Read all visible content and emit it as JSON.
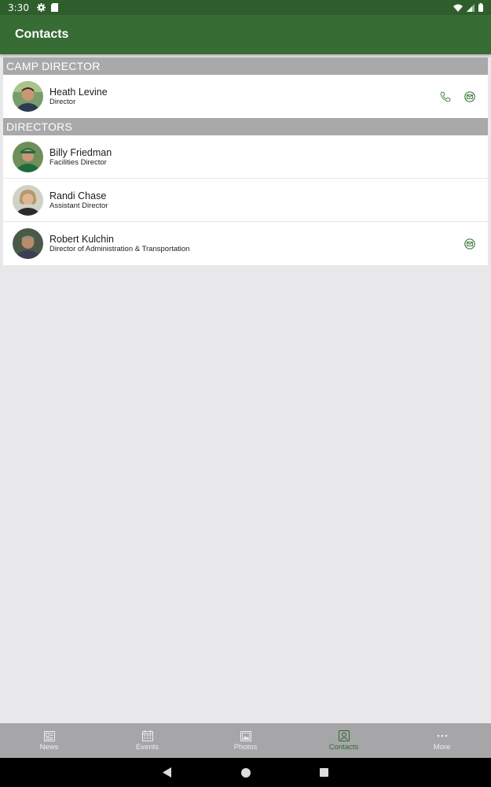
{
  "status_bar": {
    "time": "3:30",
    "icons": [
      "gear-icon",
      "sd-card-icon",
      "wifi-icon",
      "signal-icon",
      "battery-icon"
    ]
  },
  "app_bar": {
    "title": "Contacts",
    "color": "#376c34"
  },
  "sections": [
    {
      "header": "CAMP DIRECTOR",
      "contacts": [
        {
          "name": "Heath Levine",
          "role": "Director",
          "phone": true,
          "email": true
        }
      ]
    },
    {
      "header": "DIRECTORS",
      "contacts": [
        {
          "name": "Billy Friedman",
          "role": "Facilities Director",
          "phone": false,
          "email": false
        },
        {
          "name": "Randi Chase",
          "role": "Assistant Director",
          "phone": false,
          "email": false
        },
        {
          "name": "Robert Kulchin",
          "role": "Director of Administration & Transportation",
          "phone": false,
          "email": true
        }
      ]
    }
  ],
  "bottom_nav": {
    "items": [
      {
        "label": "News",
        "icon": "newspaper-icon",
        "active": false
      },
      {
        "label": "Events",
        "icon": "calendar-icon",
        "active": false
      },
      {
        "label": "Photos",
        "icon": "photo-icon",
        "active": false
      },
      {
        "label": "Contacts",
        "icon": "contacts-icon",
        "active": true
      },
      {
        "label": "More",
        "icon": "more-dots-icon",
        "active": false
      }
    ],
    "active_color": "#2f6a2e"
  },
  "system_nav": [
    "back-icon",
    "home-icon",
    "recents-icon"
  ]
}
